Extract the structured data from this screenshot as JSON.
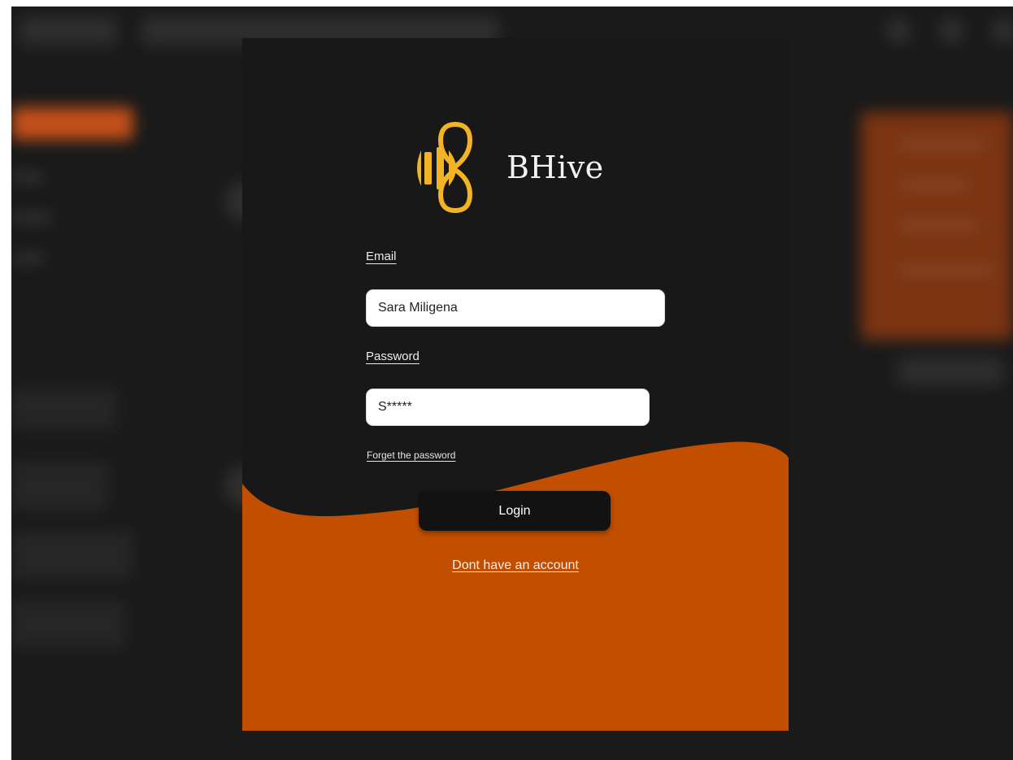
{
  "brand": {
    "name": "BHive",
    "logo_icon": "bee-logo-icon"
  },
  "login_form": {
    "email_label": "Email",
    "email_value": "Sara Miligena",
    "password_label": "Password",
    "password_value": "S*****",
    "forgot_link": "Forget the password",
    "login_button": "Login",
    "signup_link": "Dont have an account"
  },
  "colors": {
    "card_background": "#181818",
    "accent_orange": "#c24e00",
    "logo_yellow": "#f2b324",
    "input_background": "#ffffff"
  }
}
